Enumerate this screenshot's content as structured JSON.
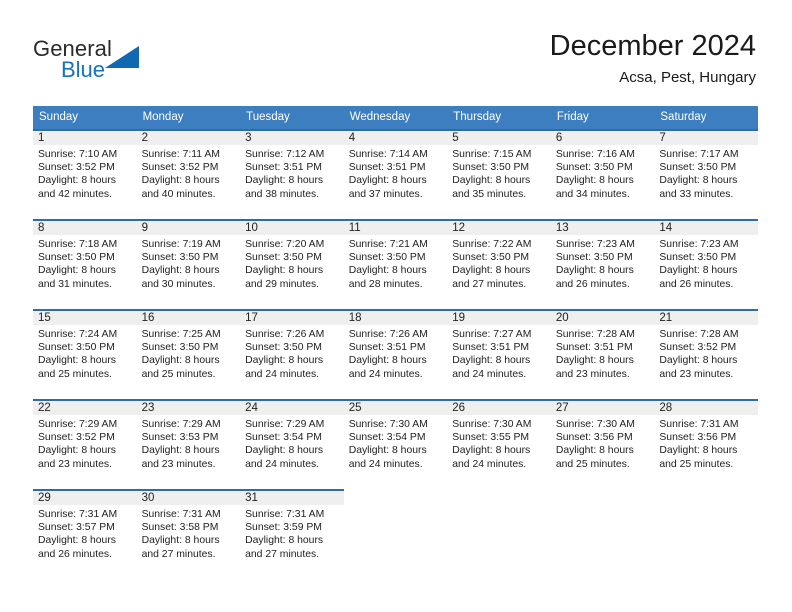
{
  "brand": {
    "name_top": "General",
    "name_bottom": "Blue",
    "accent_color": "#1068b3"
  },
  "header": {
    "title": "December 2024",
    "subtitle": "Acsa, Pest, Hungary"
  },
  "theme": {
    "header_row_bg": "#3c7ebf",
    "daynum_band_bg": "#efefef",
    "row_separator": "#2e6da4",
    "text": "#222222"
  },
  "weekdays": [
    "Sunday",
    "Monday",
    "Tuesday",
    "Wednesday",
    "Thursday",
    "Friday",
    "Saturday"
  ],
  "weeks": [
    [
      {
        "day": "1",
        "sunrise": "Sunrise: 7:10 AM",
        "sunset": "Sunset: 3:52 PM",
        "daylight1": "Daylight: 8 hours",
        "daylight2": "and 42 minutes."
      },
      {
        "day": "2",
        "sunrise": "Sunrise: 7:11 AM",
        "sunset": "Sunset: 3:52 PM",
        "daylight1": "Daylight: 8 hours",
        "daylight2": "and 40 minutes."
      },
      {
        "day": "3",
        "sunrise": "Sunrise: 7:12 AM",
        "sunset": "Sunset: 3:51 PM",
        "daylight1": "Daylight: 8 hours",
        "daylight2": "and 38 minutes."
      },
      {
        "day": "4",
        "sunrise": "Sunrise: 7:14 AM",
        "sunset": "Sunset: 3:51 PM",
        "daylight1": "Daylight: 8 hours",
        "daylight2": "and 37 minutes."
      },
      {
        "day": "5",
        "sunrise": "Sunrise: 7:15 AM",
        "sunset": "Sunset: 3:50 PM",
        "daylight1": "Daylight: 8 hours",
        "daylight2": "and 35 minutes."
      },
      {
        "day": "6",
        "sunrise": "Sunrise: 7:16 AM",
        "sunset": "Sunset: 3:50 PM",
        "daylight1": "Daylight: 8 hours",
        "daylight2": "and 34 minutes."
      },
      {
        "day": "7",
        "sunrise": "Sunrise: 7:17 AM",
        "sunset": "Sunset: 3:50 PM",
        "daylight1": "Daylight: 8 hours",
        "daylight2": "and 33 minutes."
      }
    ],
    [
      {
        "day": "8",
        "sunrise": "Sunrise: 7:18 AM",
        "sunset": "Sunset: 3:50 PM",
        "daylight1": "Daylight: 8 hours",
        "daylight2": "and 31 minutes."
      },
      {
        "day": "9",
        "sunrise": "Sunrise: 7:19 AM",
        "sunset": "Sunset: 3:50 PM",
        "daylight1": "Daylight: 8 hours",
        "daylight2": "and 30 minutes."
      },
      {
        "day": "10",
        "sunrise": "Sunrise: 7:20 AM",
        "sunset": "Sunset: 3:50 PM",
        "daylight1": "Daylight: 8 hours",
        "daylight2": "and 29 minutes."
      },
      {
        "day": "11",
        "sunrise": "Sunrise: 7:21 AM",
        "sunset": "Sunset: 3:50 PM",
        "daylight1": "Daylight: 8 hours",
        "daylight2": "and 28 minutes."
      },
      {
        "day": "12",
        "sunrise": "Sunrise: 7:22 AM",
        "sunset": "Sunset: 3:50 PM",
        "daylight1": "Daylight: 8 hours",
        "daylight2": "and 27 minutes."
      },
      {
        "day": "13",
        "sunrise": "Sunrise: 7:23 AM",
        "sunset": "Sunset: 3:50 PM",
        "daylight1": "Daylight: 8 hours",
        "daylight2": "and 26 minutes."
      },
      {
        "day": "14",
        "sunrise": "Sunrise: 7:23 AM",
        "sunset": "Sunset: 3:50 PM",
        "daylight1": "Daylight: 8 hours",
        "daylight2": "and 26 minutes."
      }
    ],
    [
      {
        "day": "15",
        "sunrise": "Sunrise: 7:24 AM",
        "sunset": "Sunset: 3:50 PM",
        "daylight1": "Daylight: 8 hours",
        "daylight2": "and 25 minutes."
      },
      {
        "day": "16",
        "sunrise": "Sunrise: 7:25 AM",
        "sunset": "Sunset: 3:50 PM",
        "daylight1": "Daylight: 8 hours",
        "daylight2": "and 25 minutes."
      },
      {
        "day": "17",
        "sunrise": "Sunrise: 7:26 AM",
        "sunset": "Sunset: 3:50 PM",
        "daylight1": "Daylight: 8 hours",
        "daylight2": "and 24 minutes."
      },
      {
        "day": "18",
        "sunrise": "Sunrise: 7:26 AM",
        "sunset": "Sunset: 3:51 PM",
        "daylight1": "Daylight: 8 hours",
        "daylight2": "and 24 minutes."
      },
      {
        "day": "19",
        "sunrise": "Sunrise: 7:27 AM",
        "sunset": "Sunset: 3:51 PM",
        "daylight1": "Daylight: 8 hours",
        "daylight2": "and 24 minutes."
      },
      {
        "day": "20",
        "sunrise": "Sunrise: 7:28 AM",
        "sunset": "Sunset: 3:51 PM",
        "daylight1": "Daylight: 8 hours",
        "daylight2": "and 23 minutes."
      },
      {
        "day": "21",
        "sunrise": "Sunrise: 7:28 AM",
        "sunset": "Sunset: 3:52 PM",
        "daylight1": "Daylight: 8 hours",
        "daylight2": "and 23 minutes."
      }
    ],
    [
      {
        "day": "22",
        "sunrise": "Sunrise: 7:29 AM",
        "sunset": "Sunset: 3:52 PM",
        "daylight1": "Daylight: 8 hours",
        "daylight2": "and 23 minutes."
      },
      {
        "day": "23",
        "sunrise": "Sunrise: 7:29 AM",
        "sunset": "Sunset: 3:53 PM",
        "daylight1": "Daylight: 8 hours",
        "daylight2": "and 23 minutes."
      },
      {
        "day": "24",
        "sunrise": "Sunrise: 7:29 AM",
        "sunset": "Sunset: 3:54 PM",
        "daylight1": "Daylight: 8 hours",
        "daylight2": "and 24 minutes."
      },
      {
        "day": "25",
        "sunrise": "Sunrise: 7:30 AM",
        "sunset": "Sunset: 3:54 PM",
        "daylight1": "Daylight: 8 hours",
        "daylight2": "and 24 minutes."
      },
      {
        "day": "26",
        "sunrise": "Sunrise: 7:30 AM",
        "sunset": "Sunset: 3:55 PM",
        "daylight1": "Daylight: 8 hours",
        "daylight2": "and 24 minutes."
      },
      {
        "day": "27",
        "sunrise": "Sunrise: 7:30 AM",
        "sunset": "Sunset: 3:56 PM",
        "daylight1": "Daylight: 8 hours",
        "daylight2": "and 25 minutes."
      },
      {
        "day": "28",
        "sunrise": "Sunrise: 7:31 AM",
        "sunset": "Sunset: 3:56 PM",
        "daylight1": "Daylight: 8 hours",
        "daylight2": "and 25 minutes."
      }
    ],
    [
      {
        "day": "29",
        "sunrise": "Sunrise: 7:31 AM",
        "sunset": "Sunset: 3:57 PM",
        "daylight1": "Daylight: 8 hours",
        "daylight2": "and 26 minutes."
      },
      {
        "day": "30",
        "sunrise": "Sunrise: 7:31 AM",
        "sunset": "Sunset: 3:58 PM",
        "daylight1": "Daylight: 8 hours",
        "daylight2": "and 27 minutes."
      },
      {
        "day": "31",
        "sunrise": "Sunrise: 7:31 AM",
        "sunset": "Sunset: 3:59 PM",
        "daylight1": "Daylight: 8 hours",
        "daylight2": "and 27 minutes."
      },
      {
        "day": "",
        "sunrise": "",
        "sunset": "",
        "daylight1": "",
        "daylight2": ""
      },
      {
        "day": "",
        "sunrise": "",
        "sunset": "",
        "daylight1": "",
        "daylight2": ""
      },
      {
        "day": "",
        "sunrise": "",
        "sunset": "",
        "daylight1": "",
        "daylight2": ""
      },
      {
        "day": "",
        "sunrise": "",
        "sunset": "",
        "daylight1": "",
        "daylight2": ""
      }
    ]
  ]
}
